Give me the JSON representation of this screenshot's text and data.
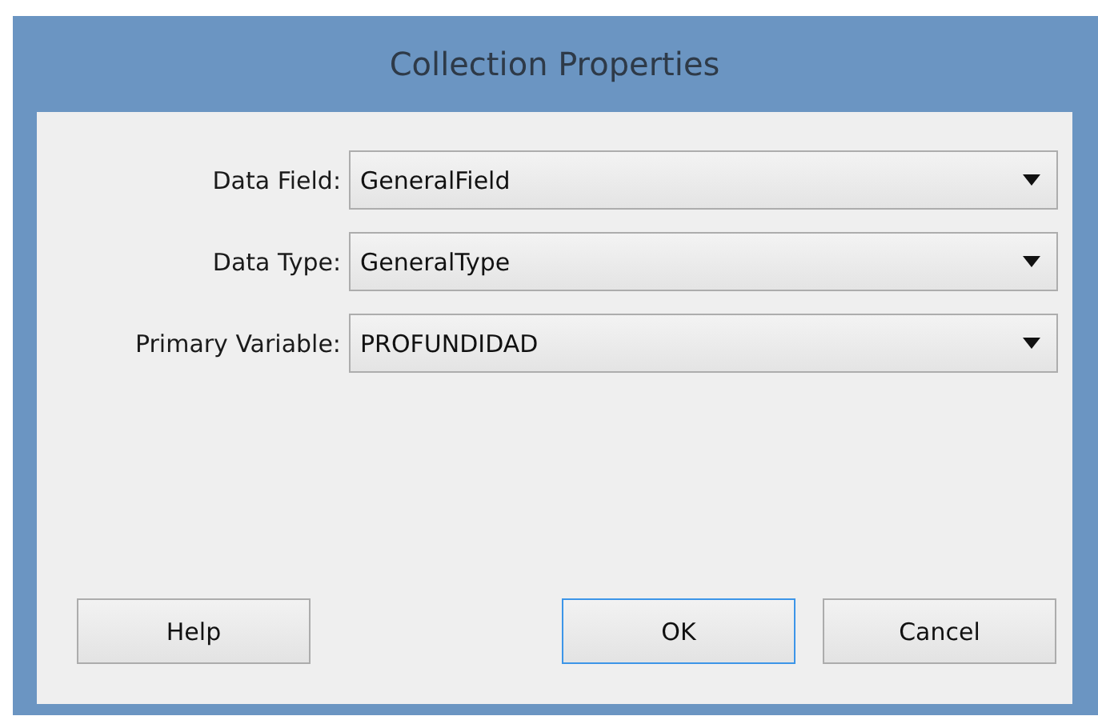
{
  "window": {
    "title": "Collection Properties"
  },
  "fields": [
    {
      "label": "Data Field:",
      "value": "GeneralField"
    },
    {
      "label": "Data Type:",
      "value": "GeneralType"
    },
    {
      "label": "Primary Variable:",
      "value": "PROFUNDIDAD"
    }
  ],
  "buttons": [
    {
      "label": "Help",
      "focused": false
    },
    {
      "label": "OK",
      "focused": true
    },
    {
      "label": "Cancel",
      "focused": false
    }
  ]
}
